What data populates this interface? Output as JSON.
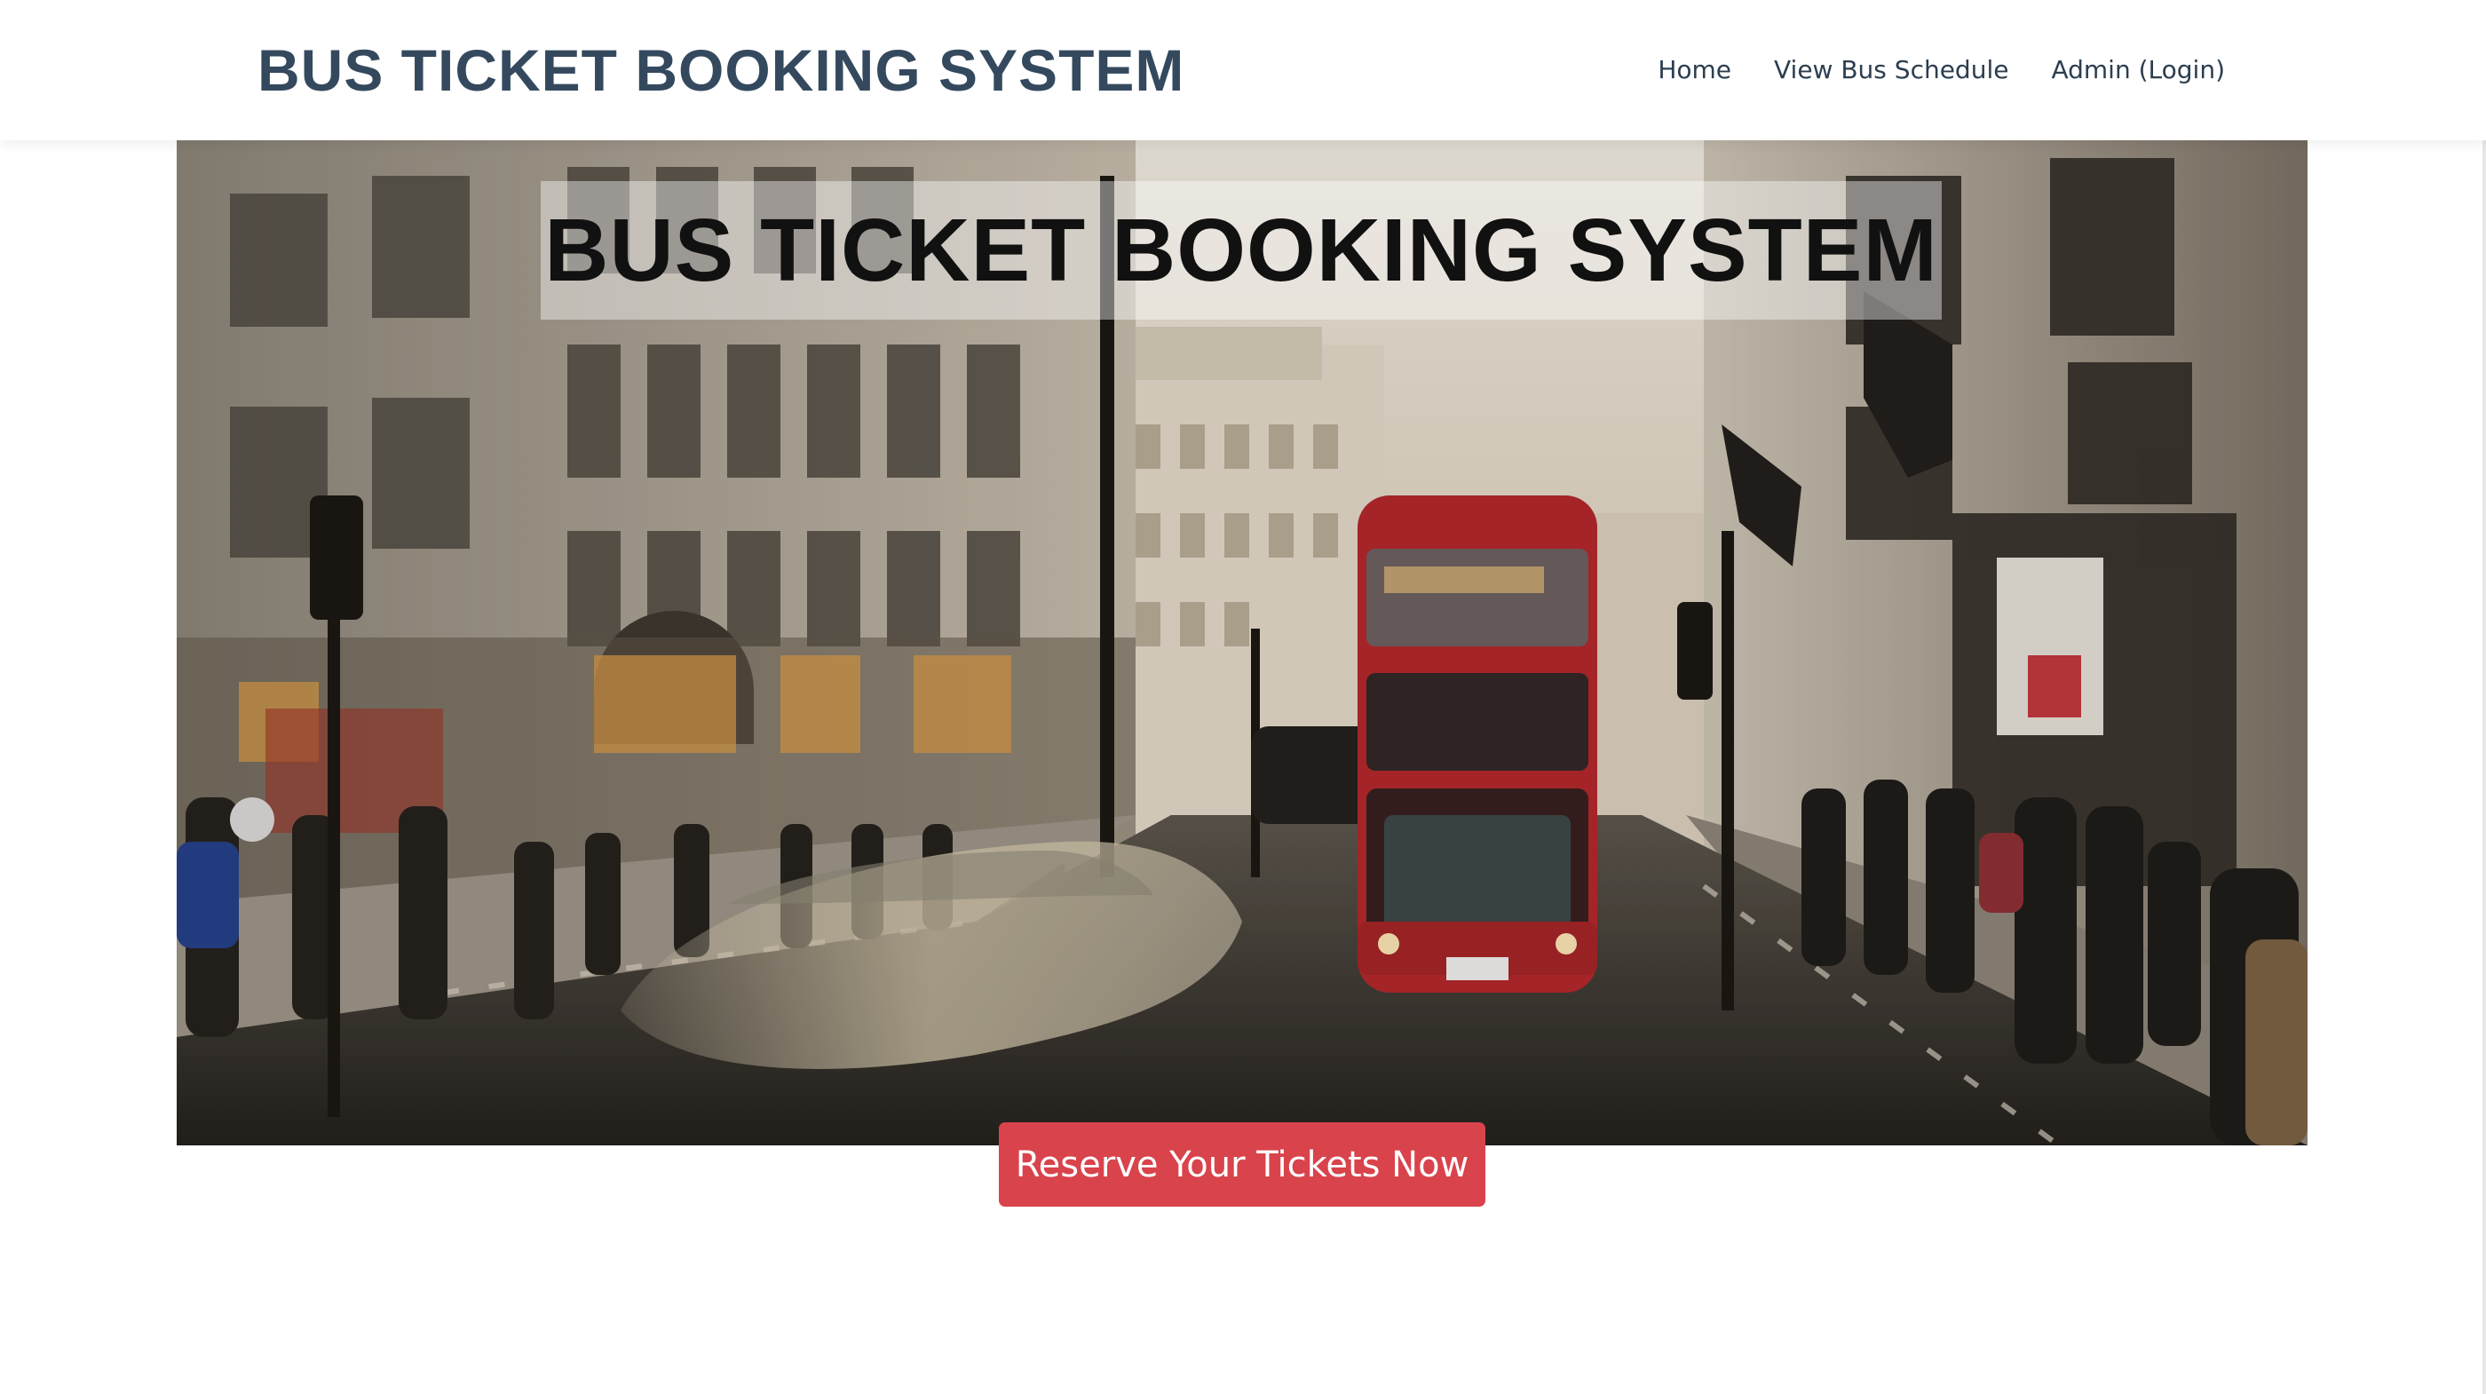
{
  "navbar": {
    "brand": "BUS TICKET BOOKING SYSTEM",
    "links": [
      {
        "label": "Home"
      },
      {
        "label": "View Bus Schedule"
      },
      {
        "label": "Admin (Login)"
      }
    ]
  },
  "hero": {
    "title": "BUS TICKET BOOKING SYSTEM",
    "image": "city-street-with-red-double-decker-bus"
  },
  "cta": {
    "label": "Reserve Your Tickets Now"
  },
  "colors": {
    "brand_text": "#34495e",
    "nav_text": "#2c3e50",
    "cta_background": "#d9434c",
    "cta_text": "#ffffff",
    "bus_red": "#b3232a"
  }
}
